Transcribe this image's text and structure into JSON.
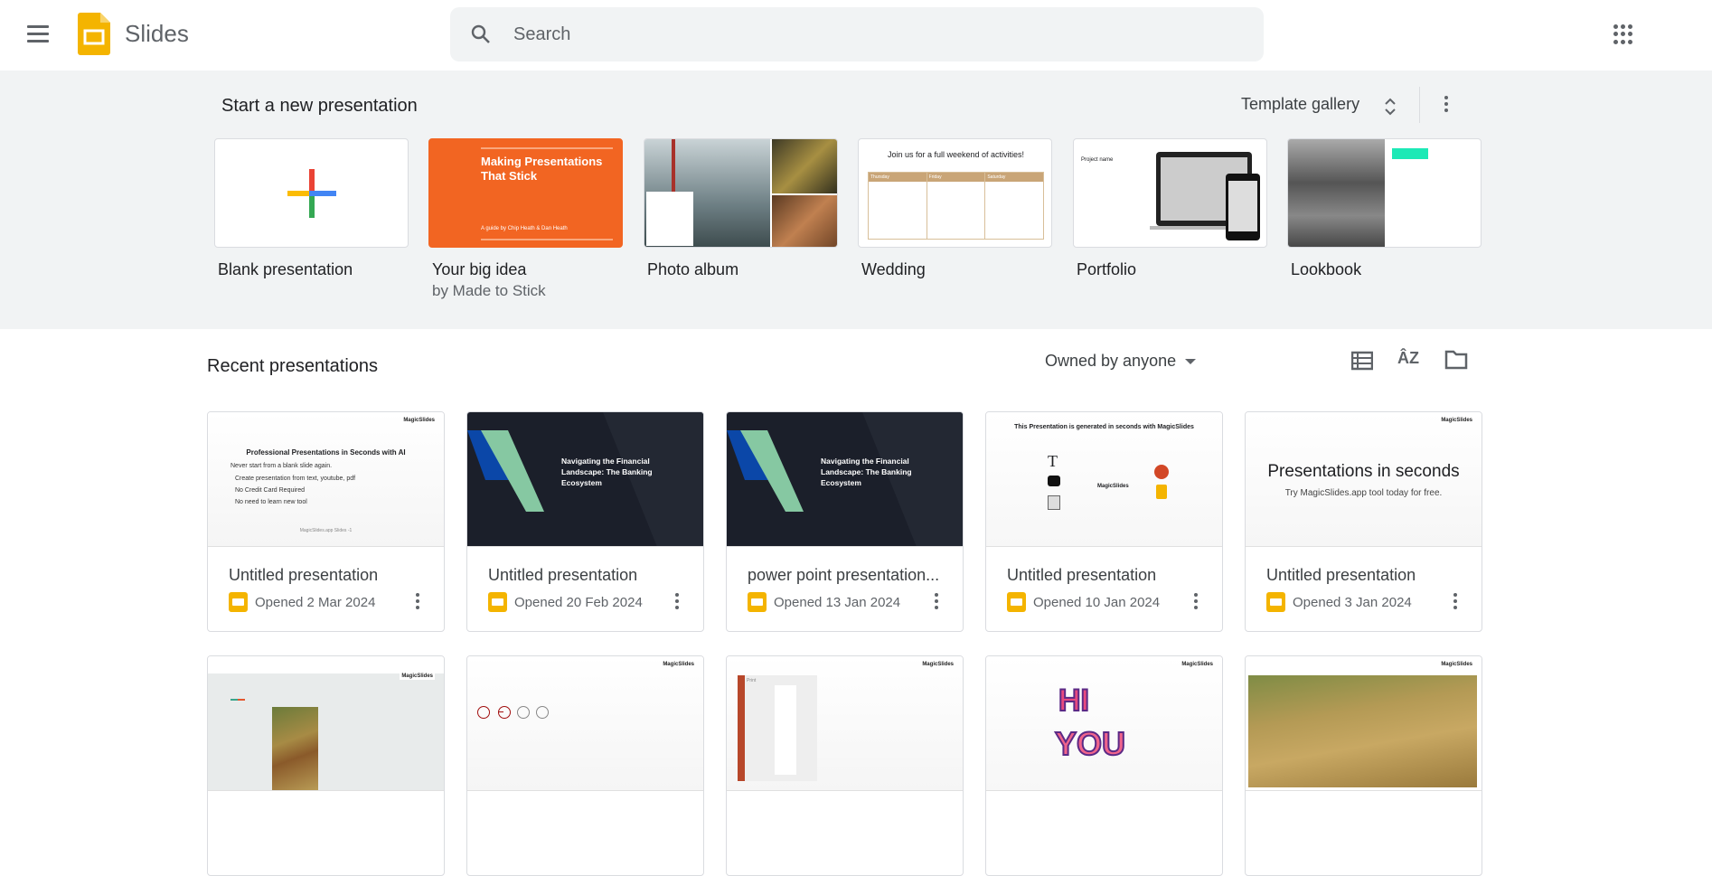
{
  "header": {
    "app_title": "Slides",
    "search_placeholder": "Search"
  },
  "new_section": {
    "title": "Start a new presentation",
    "template_gallery": "Template gallery",
    "templates": [
      {
        "label": "Blank presentation",
        "sub": ""
      },
      {
        "label": "Your big idea",
        "sub": "by Made to Stick",
        "thumb_title": "Making Presentations That Stick",
        "thumb_sub": "A guide by Chip Heath & Dan Heath"
      },
      {
        "label": "Photo album",
        "sub": ""
      },
      {
        "label": "Wedding",
        "sub": "",
        "thumb_title": "Join us for a full weekend of activities!",
        "days": [
          "Thursday",
          "Friday",
          "Saturday"
        ]
      },
      {
        "label": "Portfolio",
        "sub": "",
        "thumb_title": "Project name"
      },
      {
        "label": "Lookbook",
        "sub": ""
      }
    ]
  },
  "recent": {
    "title": "Recent presentations",
    "owner_filter": "Owned by anyone",
    "files": [
      {
        "title": "Untitled presentation",
        "opened": "Opened 2 Mar 2024",
        "thumb_title": "Professional Presentations in Seconds with AI",
        "thumb_lines": [
          "Never start from a blank slide again.",
          "Create presentation from text, youtube, pdf",
          "No Credit Card Required",
          "No need to learn new tool"
        ],
        "thumb_footer": "MagicSlides.app Slides -1"
      },
      {
        "title": "Untitled presentation",
        "opened": "Opened 20 Feb 2024",
        "thumb_title": "Navigating the Financial Landscape: The Banking Ecosystem"
      },
      {
        "title": "power point presentation...",
        "opened": "Opened 13 Jan 2024",
        "thumb_title": "Navigating the Financial Landscape: The Banking Ecosystem"
      },
      {
        "title": "Untitled presentation",
        "opened": "Opened 10 Jan 2024",
        "thumb_title": "This Presentation is generated in seconds with MagicSlides",
        "thumb_center": "MagicSlides"
      },
      {
        "title": "Untitled presentation",
        "opened": "Opened 3 Jan 2024",
        "thumb_title": "Presentations in seconds",
        "thumb_sub": "Try MagicSlides.app tool today for free."
      }
    ],
    "brand": "MagicSlides",
    "row2_hi": "HI",
    "row2_you": "YOU",
    "row2_print": "Print"
  },
  "colors": {
    "accent": "#f4b400",
    "band": "#f1f3f4",
    "orange": "#f26522"
  }
}
